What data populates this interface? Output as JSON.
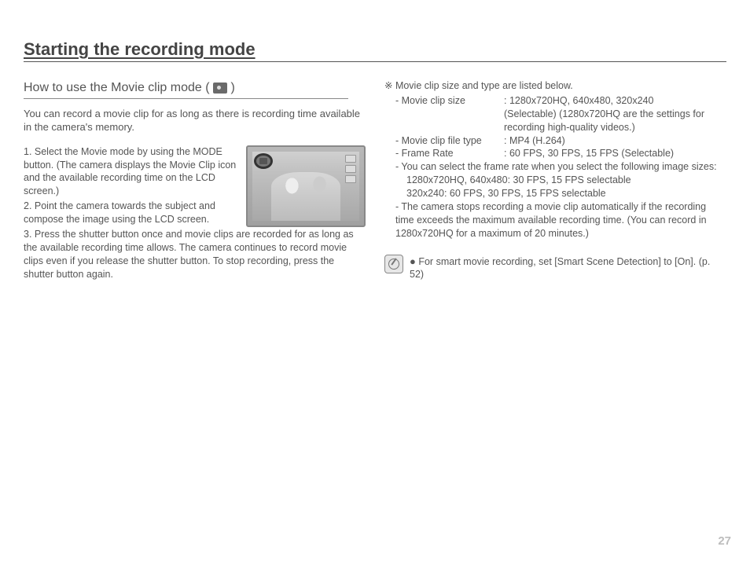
{
  "title": "Starting the recording mode",
  "section_heading_prefix": "How to use the Movie clip mode ( ",
  "section_heading_suffix": " )",
  "intro": "You can record a movie clip for as long as there is recording time available in the camera's memory.",
  "steps": {
    "s1": "1. Select the Movie mode by using the MODE button. (The camera displays the Movie Clip icon and the available recording time on the LCD screen.)",
    "s2": "2. Point the camera towards the subject and compose the image using the LCD screen.",
    "s3": "3. Press the shutter button once and movie clips are recorded for as long as the available recording time allows. The camera continues to record movie clips even if you release the shutter button. To stop recording, press the shutter button again."
  },
  "right": {
    "head": "※ Movie clip size and type are listed below.",
    "size_label": "- Movie clip size",
    "size_value": ": 1280x720HQ, 640x480, 320x240",
    "size_value2": "(Selectable) (1280x720HQ are the settings for recording high-quality videos.)",
    "filetype_label": "- Movie clip file type",
    "filetype_value": ": MP4 (H.264)",
    "fps_label": "- Frame Rate",
    "fps_value": ": 60 FPS, 30 FPS, 15 FPS (Selectable)",
    "sel_line1": "- You can select the frame rate when you select the following image sizes:",
    "sel_line2": "1280x720HQ, 640x480: 30 FPS, 15 FPS selectable",
    "sel_line3": "320x240: 60 FPS, 30 FPS, 15 FPS selectable",
    "stop_line1": "- The camera stops recording a movie clip automatically if the recording time exceeds the maximum available recording time. (You can record in 1280x720HQ for a maximum of 20 minutes.)",
    "note_bullet": "●",
    "note_text": "For smart movie recording, set [Smart Scene Detection] to [On]. (p. 52)"
  },
  "page_number": "27"
}
